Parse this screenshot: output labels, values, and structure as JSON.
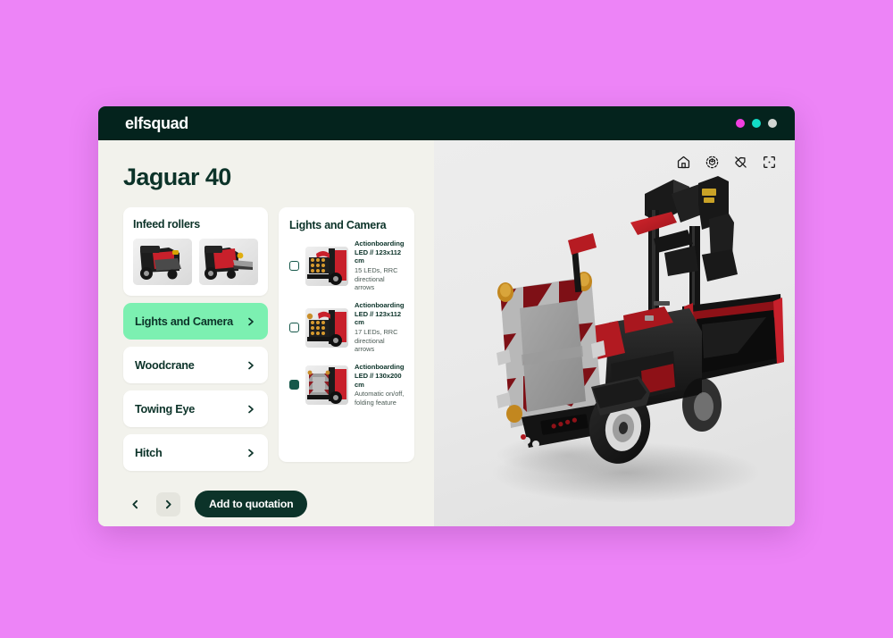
{
  "window": {
    "brand": "elfsquad",
    "dots": [
      {
        "name": "window-dot-magenta",
        "color": "#F13FE0"
      },
      {
        "name": "window-dot-cyan",
        "color": "#12DCC6"
      },
      {
        "name": "window-dot-grey",
        "color": "#D2D6D3"
      }
    ]
  },
  "config": {
    "page_title": "Jaguar 40",
    "infeed": {
      "heading": "Infeed rollers",
      "thumbnails": [
        {
          "name": "infeed-thumb-1",
          "alt": "machine-rear-open-bed"
        },
        {
          "name": "infeed-thumb-2",
          "alt": "machine-rear-conveyor"
        }
      ]
    },
    "nav_items": [
      {
        "label": "Lights and Camera",
        "selected": true,
        "icon": "chevron-right-icon"
      },
      {
        "label": "Woodcrane",
        "selected": false,
        "icon": "chevron-right-icon"
      },
      {
        "label": "Towing Eye",
        "selected": false,
        "icon": "chevron-right-icon"
      },
      {
        "label": "Hitch",
        "selected": false,
        "icon": "chevron-right-icon"
      }
    ],
    "lights_panel": {
      "heading": "Lights and Camera",
      "options": [
        {
          "title": "Actionboarding LED // 123x112 cm",
          "subtitle": "15 LEDs, RRC directional arrows",
          "selected": false,
          "thumb_alt": "actionboard-led-15"
        },
        {
          "title": "Actionboarding LED // 123x112 cm",
          "subtitle": "17 LEDs, RRC directional arrows",
          "selected": false,
          "thumb_alt": "actionboard-led-17"
        },
        {
          "title": "Actionboarding LED // 130x200 cm",
          "subtitle": "Automatic on/off, folding feature",
          "selected": true,
          "thumb_alt": "actionboard-folding"
        }
      ]
    },
    "footer": {
      "prev_label": "Previous step",
      "next_label": "Next step",
      "quote_label": "Add to quotation"
    }
  },
  "viewer": {
    "tools": [
      {
        "name": "home-icon",
        "label": "Reset view"
      },
      {
        "name": "orbit-icon",
        "label": "Orbit / rotate"
      },
      {
        "name": "hide-icon",
        "label": "Hide labels"
      },
      {
        "name": "fullscreen-icon",
        "label": "Fullscreen"
      }
    ],
    "model_alt": "jaguar-40-truck-with-actionboard"
  },
  "theme": {
    "brand_dark": "#04231D",
    "accent_mint": "#7CF0B1",
    "page_bg": "#ED84F7",
    "panel_bg": "#F2F2EC",
    "viewer_bg": "#EAEAEA"
  }
}
